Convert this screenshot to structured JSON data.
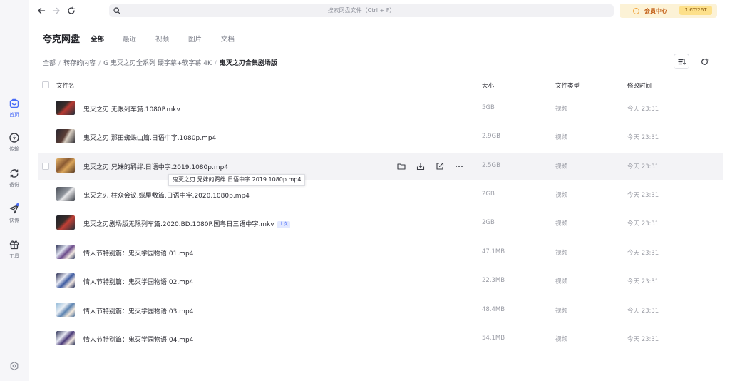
{
  "sidebar": {
    "items": [
      {
        "label": "首页",
        "icon": "home-icon"
      },
      {
        "label": "传输",
        "icon": "transfer-icon"
      },
      {
        "label": "备份",
        "icon": "backup-icon"
      },
      {
        "label": "快传",
        "icon": "quick-send-icon"
      },
      {
        "label": "工具",
        "icon": "tools-icon"
      }
    ],
    "accent": "#4a6cf7"
  },
  "topbar": {
    "search_placeholder": "搜索网盘文件（Ctrl + F）",
    "vip_label": "会员中心",
    "capacity": "1.6T/26T"
  },
  "header": {
    "app_title": "夸克网盘",
    "tabs": [
      {
        "label": "全部",
        "active": true
      },
      {
        "label": "最近",
        "active": false
      },
      {
        "label": "视频",
        "active": false
      },
      {
        "label": "图片",
        "active": false
      },
      {
        "label": "文档",
        "active": false
      }
    ]
  },
  "breadcrumb": {
    "items": [
      "全部",
      "转存的内容",
      "G 鬼灭之刃全系列 硬字幕+软字幕 4K"
    ],
    "current": "鬼灭之刃合集剧场版"
  },
  "table": {
    "columns": {
      "name": "文件名",
      "size": "大小",
      "type": "文件类型",
      "modified": "修改时间"
    },
    "rows": [
      {
        "name": "鬼灭之刃 无限列车篇.1080P.mkv",
        "size": "5GB",
        "type": "视频",
        "modified": "今天 23:31",
        "badge": ""
      },
      {
        "name": "鬼灭之刃.那田蜘蛛山篇.日语中字.1080p.mp4",
        "size": "2.9GB",
        "type": "视频",
        "modified": "今天 23:31",
        "badge": ""
      },
      {
        "name": "鬼灭之刃.兄妹的羁绊.日语中字.2019.1080p.mp4",
        "size": "2.5GB",
        "type": "视频",
        "modified": "今天 23:31",
        "badge": ""
      },
      {
        "name": "鬼灭之刃.柱众会议.蝶屋敷篇.日语中字.2020.1080p.mp4",
        "size": "2GB",
        "type": "视频",
        "modified": "今天 23:31",
        "badge": ""
      },
      {
        "name": "鬼灭之刃剧场版无限列车篇.2020.BD.1080P.国粤日三语中字.mkv",
        "size": "2GB",
        "type": "视频",
        "modified": "今天 23:31",
        "badge": "上次"
      },
      {
        "name": "情人节特别篇：鬼灭学园物语 01.mp4",
        "size": "47.1MB",
        "type": "视频",
        "modified": "今天 23:31",
        "badge": ""
      },
      {
        "name": "情人节特别篇：鬼灭学园物语 02.mp4",
        "size": "22.3MB",
        "type": "视频",
        "modified": "今天 23:31",
        "badge": ""
      },
      {
        "name": "情人节特别篇：鬼灭学园物语 03.mp4",
        "size": "48.4MB",
        "type": "视频",
        "modified": "今天 23:31",
        "badge": ""
      },
      {
        "name": "情人节特别篇：鬼灭学园物语 04.mp4",
        "size": "54.1MB",
        "type": "视频",
        "modified": "今天 23:31",
        "badge": ""
      }
    ],
    "hover_row_index": 2,
    "row_actions": [
      "folder-icon",
      "download-icon",
      "share-icon",
      "more-icon"
    ]
  },
  "tooltip": {
    "text": "鬼灭之刃.兄妹的羁绊.日语中字.2019.1080p.mp4"
  }
}
